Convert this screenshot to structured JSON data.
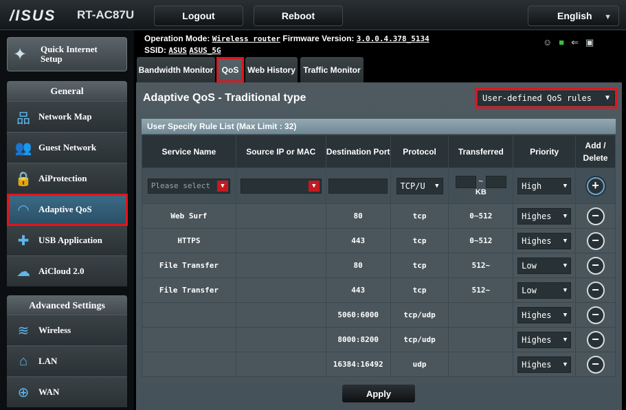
{
  "header": {
    "logo": "/ISUS",
    "model": "RT-AC87U",
    "logout_label": "Logout",
    "reboot_label": "Reboot",
    "language": "English"
  },
  "status": {
    "operation_mode_label": "Operation Mode:",
    "operation_mode_value": "Wireless router",
    "firmware_label": "Firmware Version:",
    "firmware_value": "3.0.0.4.378_5134",
    "ssid_label": "SSID:",
    "ssid_1": "ASUS",
    "ssid_2": "ASUS_5G"
  },
  "sidebar": {
    "quick_setup_line1": "Quick Internet",
    "quick_setup_line2": "Setup",
    "general_label": "General",
    "general_items": [
      {
        "label": "Network Map",
        "icon": "network-map-icon"
      },
      {
        "label": "Guest Network",
        "icon": "guest-network-icon"
      },
      {
        "label": "AiProtection",
        "icon": "lock-icon"
      },
      {
        "label": "Adaptive QoS",
        "icon": "speedometer-icon"
      },
      {
        "label": "USB Application",
        "icon": "puzzle-icon"
      },
      {
        "label": "AiCloud 2.0",
        "icon": "cloud-icon"
      }
    ],
    "advanced_label": "Advanced Settings",
    "advanced_items": [
      {
        "label": "Wireless",
        "icon": "wifi-icon"
      },
      {
        "label": "LAN",
        "icon": "home-icon"
      },
      {
        "label": "WAN",
        "icon": "globe-icon"
      }
    ]
  },
  "tabs": [
    "Bandwidth Monitor",
    "QoS",
    "Web History",
    "Traffic Monitor"
  ],
  "main": {
    "title": "Adaptive QoS - Traditional type",
    "mode_select": "User-defined QoS rules",
    "list_title": "User Specify Rule List (Max Limit : 32)",
    "columns": [
      "Service Name",
      "Source IP or MAC",
      "Destination Port",
      "Protocol",
      "Transferred",
      "Priority",
      "Add / Delete"
    ],
    "input_row": {
      "service_placeholder": "Please select",
      "protocol": "TCP/U",
      "transferred_sep": "~",
      "transferred_unit": "KB",
      "priority": "High"
    },
    "rows": [
      {
        "service": "Web Surf",
        "source": "",
        "port": "80",
        "protocol": "tcp",
        "transferred": "0~512",
        "priority": "Highes"
      },
      {
        "service": "HTTPS",
        "source": "",
        "port": "443",
        "protocol": "tcp",
        "transferred": "0~512",
        "priority": "Highes"
      },
      {
        "service": "File Transfer",
        "source": "",
        "port": "80",
        "protocol": "tcp",
        "transferred": "512~",
        "priority": "Low"
      },
      {
        "service": "File Transfer",
        "source": "",
        "port": "443",
        "protocol": "tcp",
        "transferred": "512~",
        "priority": "Low"
      },
      {
        "service": "",
        "source": "",
        "port": "5060:6000",
        "protocol": "tcp/udp",
        "transferred": "",
        "priority": "Highes"
      },
      {
        "service": "",
        "source": "",
        "port": "8000:8200",
        "protocol": "tcp/udp",
        "transferred": "",
        "priority": "Highes"
      },
      {
        "service": "",
        "source": "",
        "port": "16384:16492",
        "protocol": "udp",
        "transferred": "",
        "priority": "Highes"
      }
    ],
    "apply_label": "Apply"
  },
  "colors": {
    "highlight": "#e3141b",
    "accent": "#5fb6e8",
    "active_nav": "#3c6b87"
  }
}
